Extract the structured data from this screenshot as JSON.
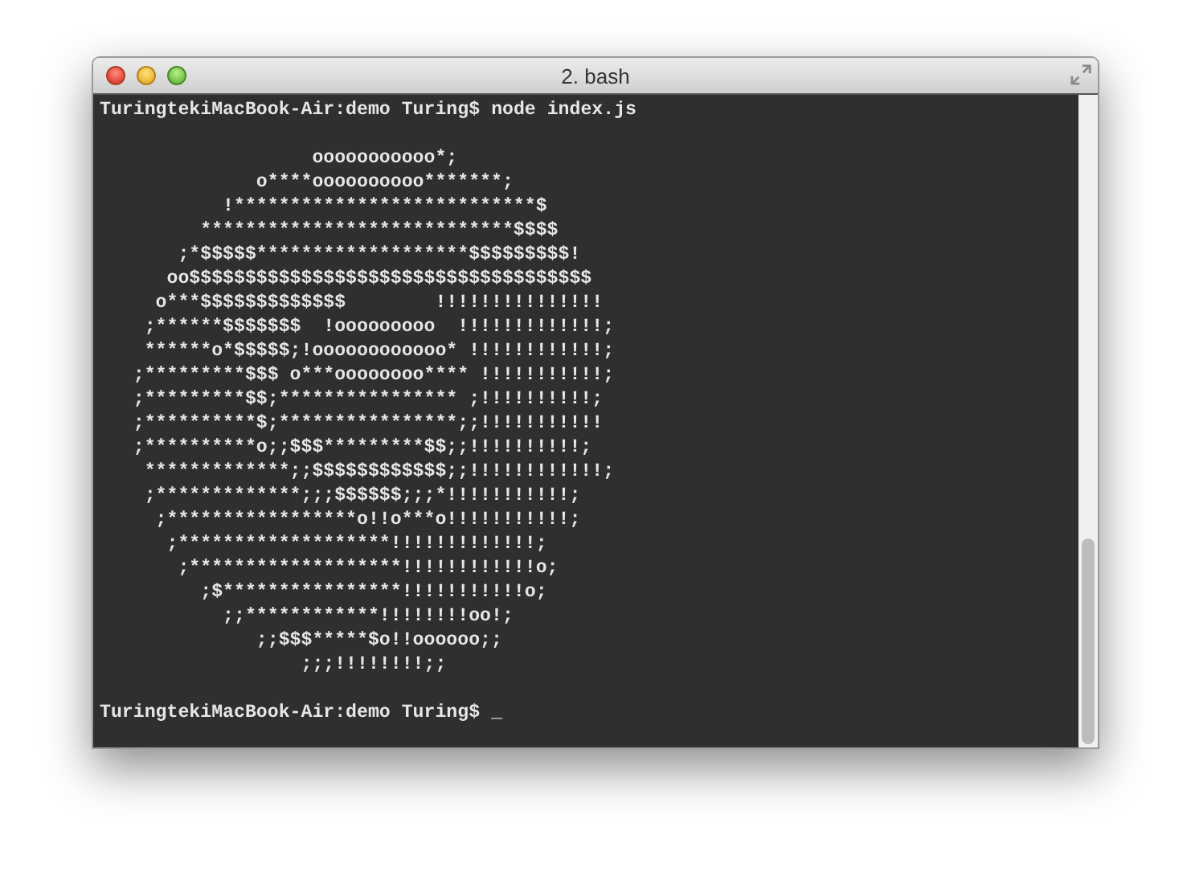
{
  "window": {
    "title": "2. bash"
  },
  "terminal": {
    "command_line": {
      "prompt": "TuringtekiMacBook-Air:demo Turing$",
      "command": "node index.js"
    },
    "output": [
      "                   ooooooooooo*;",
      "              o****oooooooooo*******;",
      "           !***************************$",
      "         ****************************$$$$",
      "       ;*$$$$$*******************$$$$$$$$$!",
      "      oo$$$$$$$$$$$$$$$$$$$$$$$$$$$$$$$$$$$$",
      "     o***$$$$$$$$$$$$$        !!!!!!!!!!!!!!!",
      "    ;******$$$$$$$  !ooooooooo  !!!!!!!!!!!!!;",
      "    ******o*$$$$$;!oooooooooooo* !!!!!!!!!!!!;",
      "   ;*********$$$ o***oooooooo**** !!!!!!!!!!!;",
      "   ;*********$$;**************** ;!!!!!!!!!!;",
      "   ;**********$;****************;;!!!!!!!!!!!",
      "   ;**********o;;$$$*********$$;;!!!!!!!!!!;",
      "    *************;;$$$$$$$$$$$$;;!!!!!!!!!!!!;",
      "    ;*************;;;$$$$$$;;;*!!!!!!!!!!!;",
      "     ;*****************o!!o***o!!!!!!!!!!!;",
      "      ;*******************!!!!!!!!!!!!!;",
      "       ;*******************!!!!!!!!!!!!o;",
      "         ;$****************!!!!!!!!!!!o;",
      "           ;;************!!!!!!!!oo!;",
      "              ;;$$$*****$o!!oooooo;;",
      "                  ;;;!!!!!!!!;;"
    ],
    "prompt_line": {
      "prompt": "TuringtekiMacBook-Air:demo Turing$",
      "cursor": "_"
    }
  }
}
